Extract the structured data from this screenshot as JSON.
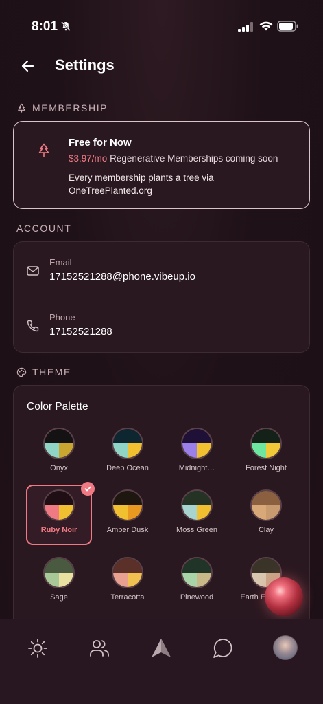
{
  "status_bar": {
    "time": "8:01"
  },
  "header": {
    "title": "Settings"
  },
  "membership": {
    "section_label": "MEMBERSHIP",
    "title": "Free for Now",
    "price": "$3.97/mo",
    "price_suffix": "Regenerative Memberships coming soon",
    "description": "Every membership plants a tree via OneTreePlanted.org"
  },
  "account": {
    "section_label": "ACCOUNT",
    "email_label": "Email",
    "email_value": "17152521288@phone.vibeup.io",
    "phone_label": "Phone",
    "phone_value": "17152521288"
  },
  "theme": {
    "section_label": "THEME",
    "palette_title": "Color Palette",
    "palettes": [
      {
        "name": "Onyx",
        "top": "#151214",
        "bl": "#8fd4c4",
        "br": "#c8a630",
        "selected": false
      },
      {
        "name": "Deep Ocean",
        "top": "#0d2630",
        "bl": "#8fd4c4",
        "br": "#f0c030",
        "selected": false
      },
      {
        "name": "Midnight…",
        "top": "#1e1036",
        "bl": "#9a80e8",
        "br": "#f0c030",
        "selected": false
      },
      {
        "name": "Forest Night",
        "top": "#132118",
        "bl": "#6ee6a0",
        "br": "#f0c838",
        "selected": false
      },
      {
        "name": "Ruby Noir",
        "top": "#1f0f14",
        "bl": "#f07a84",
        "br": "#f0c030",
        "selected": true
      },
      {
        "name": "Amber Dusk",
        "top": "#1e1710",
        "bl": "#f0c030",
        "br": "#e89a20",
        "selected": false
      },
      {
        "name": "Moss Green",
        "top": "#253325",
        "bl": "#a8d4d0",
        "br": "#f0c030",
        "selected": false
      },
      {
        "name": "Clay",
        "top": "#8a6040",
        "bl": "#d8a878",
        "br": "#c89a70",
        "selected": false
      },
      {
        "name": "Sage",
        "top": "#4a5a40",
        "bl": "#a8c898",
        "br": "#e8e0a0",
        "selected": false
      },
      {
        "name": "Terracotta",
        "top": "#5a3028",
        "bl": "#e8a090",
        "br": "#f0c050",
        "selected": false
      },
      {
        "name": "Pinewood",
        "top": "#203428",
        "bl": "#a8d4a8",
        "br": "#c8b888",
        "selected": false
      },
      {
        "name": "Earth Elements",
        "top": "#3a3428",
        "bl": "#d8c8b0",
        "br": "#c8a888",
        "selected": false
      }
    ]
  },
  "colors": {
    "accent": "#f07a84",
    "background": "#1f1118",
    "card": "#2a1820",
    "nav": "#281720"
  },
  "nav": {
    "items": [
      "sun-icon",
      "users-icon",
      "vibeup-logo-icon",
      "chat-icon",
      "profile-avatar"
    ]
  }
}
